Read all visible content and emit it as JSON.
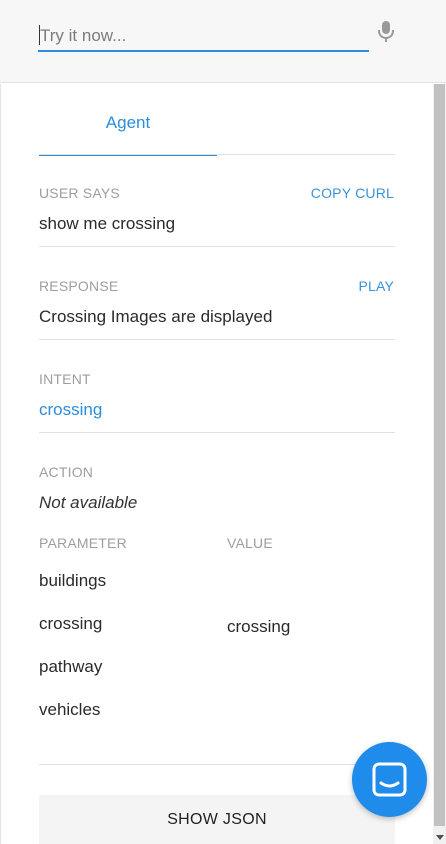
{
  "search": {
    "placeholder": "Try it now..."
  },
  "icons": {
    "mic": "microphone-icon",
    "chat": "chat-icon"
  },
  "colors": {
    "accent": "#2b8ddc",
    "chat_bubble": "#1f8ceb"
  },
  "tabs": [
    {
      "label": "Agent"
    }
  ],
  "user_says": {
    "label": "USER SAYS",
    "action": "COPY CURL",
    "value": "show me crossing"
  },
  "response": {
    "label": "RESPONSE",
    "action": "PLAY",
    "value": "Crossing Images are displayed"
  },
  "intent": {
    "label": "INTENT",
    "value": "crossing"
  },
  "action_section": {
    "label": "ACTION",
    "value": "Not available"
  },
  "parameters": {
    "header_parameter": "PARAMETER",
    "header_value": "VALUE",
    "rows": [
      {
        "name": "buildings",
        "value": ""
      },
      {
        "name": "crossing",
        "value": "crossing"
      },
      {
        "name": "pathway",
        "value": ""
      },
      {
        "name": "vehicles",
        "value": ""
      }
    ]
  },
  "footer": {
    "show_json_label": "SHOW JSON"
  }
}
